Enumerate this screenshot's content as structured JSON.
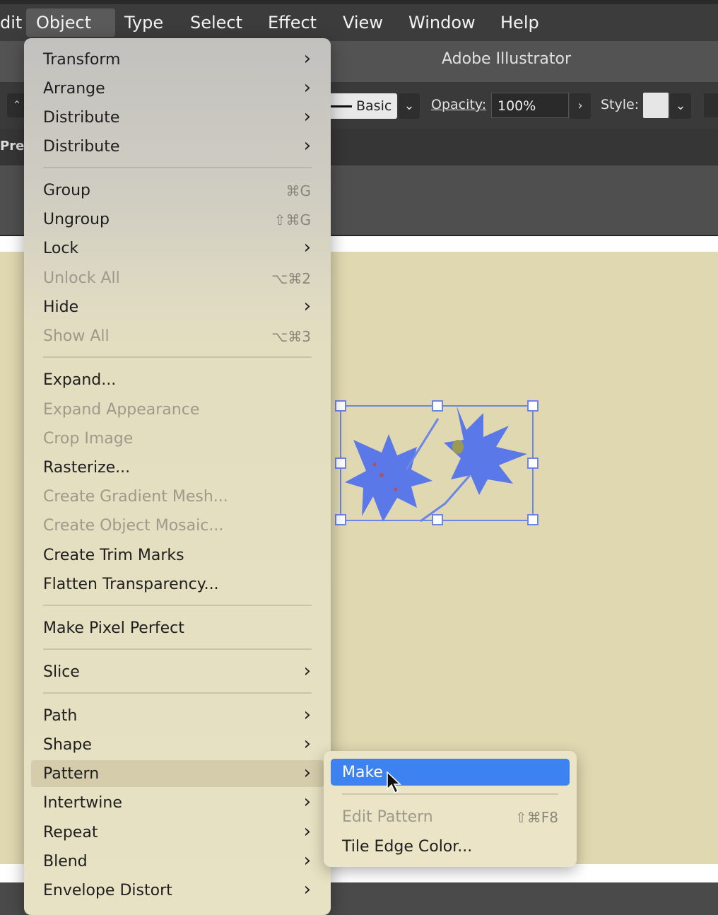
{
  "menubar": {
    "items": [
      {
        "label": "dit"
      },
      {
        "label": "Object"
      },
      {
        "label": "Type"
      },
      {
        "label": "Select"
      },
      {
        "label": "Effect"
      },
      {
        "label": "View"
      },
      {
        "label": "Window"
      },
      {
        "label": "Help"
      }
    ]
  },
  "window": {
    "title": "Adobe Illustrator"
  },
  "control_bar": {
    "stroke_style": "Basic",
    "opacity_label": "Opacity:",
    "opacity_value": "100%",
    "style_label": "Style:"
  },
  "tab": {
    "label": "Prev"
  },
  "object_menu": {
    "items": [
      {
        "label": "Transform",
        "shortcut": "",
        "submenu": true,
        "enabled": true
      },
      {
        "label": "Arrange",
        "shortcut": "",
        "submenu": true,
        "enabled": true
      },
      {
        "label": "Distribute",
        "shortcut": "",
        "submenu": true,
        "enabled": true
      },
      {
        "label": "Distribute",
        "shortcut": "",
        "submenu": true,
        "enabled": true
      },
      {
        "label": "Group",
        "shortcut": "⌘G",
        "submenu": false,
        "enabled": true
      },
      {
        "label": "Ungroup",
        "shortcut": "⇧⌘G",
        "submenu": false,
        "enabled": true
      },
      {
        "label": "Lock",
        "shortcut": "",
        "submenu": true,
        "enabled": true
      },
      {
        "label": "Unlock All",
        "shortcut": "⌥⌘2",
        "submenu": false,
        "enabled": false
      },
      {
        "label": "Hide",
        "shortcut": "",
        "submenu": true,
        "enabled": true
      },
      {
        "label": "Show All",
        "shortcut": "⌥⌘3",
        "submenu": false,
        "enabled": false
      },
      {
        "label": "Expand...",
        "shortcut": "",
        "submenu": false,
        "enabled": true
      },
      {
        "label": "Expand Appearance",
        "shortcut": "",
        "submenu": false,
        "enabled": false
      },
      {
        "label": "Crop Image",
        "shortcut": "",
        "submenu": false,
        "enabled": false
      },
      {
        "label": "Rasterize...",
        "shortcut": "",
        "submenu": false,
        "enabled": true
      },
      {
        "label": "Create Gradient Mesh...",
        "shortcut": "",
        "submenu": false,
        "enabled": false
      },
      {
        "label": "Create Object Mosaic...",
        "shortcut": "",
        "submenu": false,
        "enabled": false
      },
      {
        "label": "Create Trim Marks",
        "shortcut": "",
        "submenu": false,
        "enabled": true
      },
      {
        "label": "Flatten Transparency...",
        "shortcut": "",
        "submenu": false,
        "enabled": true
      },
      {
        "label": "Make Pixel Perfect",
        "shortcut": "",
        "submenu": false,
        "enabled": true
      },
      {
        "label": "Slice",
        "shortcut": "",
        "submenu": true,
        "enabled": true
      },
      {
        "label": "Path",
        "shortcut": "",
        "submenu": true,
        "enabled": true
      },
      {
        "label": "Shape",
        "shortcut": "",
        "submenu": true,
        "enabled": true
      },
      {
        "label": "Pattern",
        "shortcut": "",
        "submenu": true,
        "enabled": true,
        "highlighted": true
      },
      {
        "label": "Intertwine",
        "shortcut": "",
        "submenu": true,
        "enabled": true
      },
      {
        "label": "Repeat",
        "shortcut": "",
        "submenu": true,
        "enabled": true
      },
      {
        "label": "Blend",
        "shortcut": "",
        "submenu": true,
        "enabled": true
      },
      {
        "label": "Envelope Distort",
        "shortcut": "",
        "submenu": true,
        "enabled": true
      }
    ]
  },
  "pattern_submenu": {
    "items": [
      {
        "label": "Make",
        "shortcut": "",
        "enabled": true,
        "selected": true
      },
      {
        "label": "Edit Pattern",
        "shortcut": "⇧⌘F8",
        "enabled": false
      },
      {
        "label": "Tile Edge Color...",
        "shortcut": "",
        "enabled": true
      }
    ]
  },
  "colors": {
    "canvas": "#e0d8b0",
    "selection": "#5b78e8",
    "highlight": "#3c82f0"
  }
}
